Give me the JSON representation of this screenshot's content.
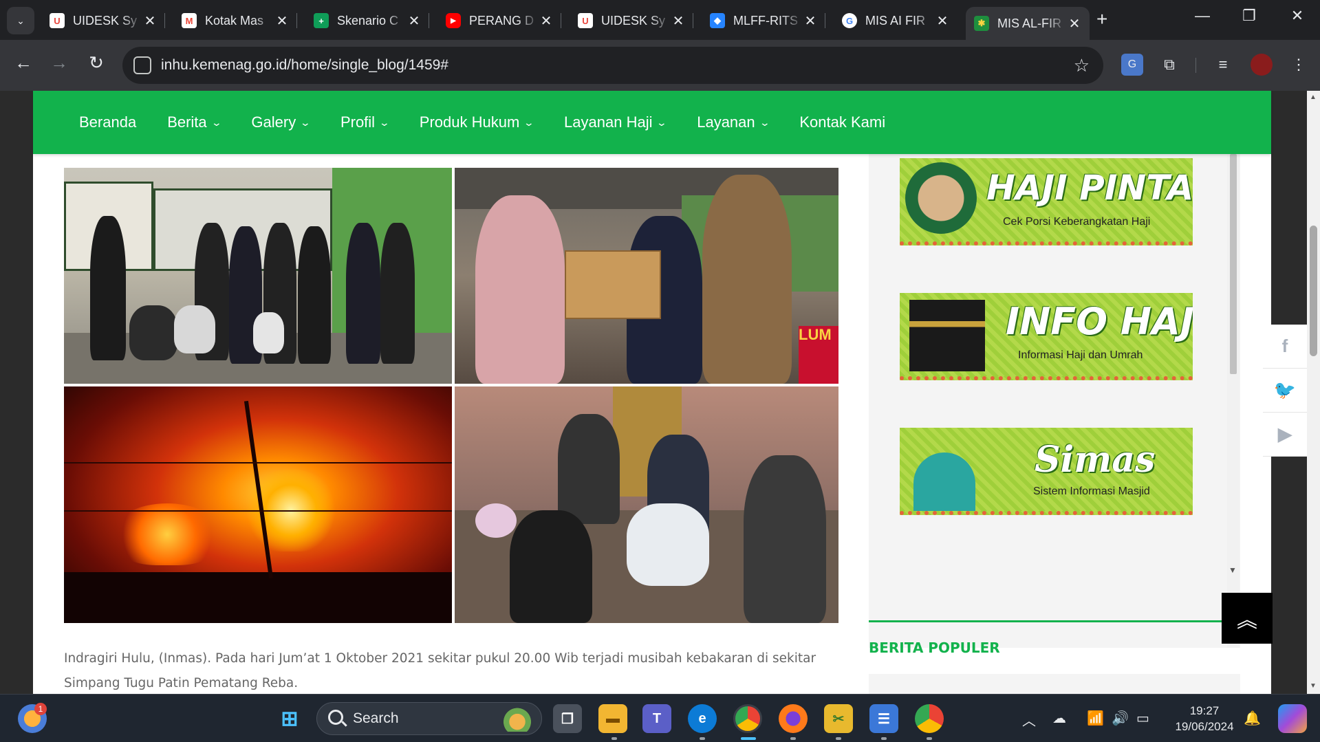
{
  "browser": {
    "tabs": [
      {
        "title": "UIDESK Sy",
        "favicon": "uidesk-icon",
        "color": "#e8453c"
      },
      {
        "title": "Kotak Mas",
        "favicon": "gmail-icon",
        "color": "#ea4335"
      },
      {
        "title": "Skenario C",
        "favicon": "sheets-icon",
        "color": "#0f9d58"
      },
      {
        "title": "PERANG D",
        "favicon": "youtube-icon",
        "color": "#ff0000"
      },
      {
        "title": "UIDESK Sy",
        "favicon": "uidesk-icon",
        "color": "#e8453c"
      },
      {
        "title": "MLFF-RITS",
        "favicon": "jira-icon",
        "color": "#2684ff"
      },
      {
        "title": "MIS AI FIR",
        "favicon": "google-icon",
        "color": "#4285f4"
      },
      {
        "title": "MIS AL-FIR",
        "favicon": "kemenag-icon",
        "color": "#1e8e3e",
        "active": true
      }
    ],
    "url": "inhu.kemenag.go.id/home/single_blog/1459#"
  },
  "nav": {
    "items": [
      {
        "label": "Beranda",
        "dropdown": false
      },
      {
        "label": "Berita",
        "dropdown": true
      },
      {
        "label": "Galery",
        "dropdown": true
      },
      {
        "label": "Profil",
        "dropdown": true
      },
      {
        "label": "Produk Hukum",
        "dropdown": true
      },
      {
        "label": "Layanan Haji",
        "dropdown": true
      },
      {
        "label": "Layanan",
        "dropdown": true
      },
      {
        "label": "Kontak Kami",
        "dropdown": false
      }
    ]
  },
  "article": {
    "text": "Indragiri Hulu, (Inmas). Pada hari Jum’at 1 Oktober 2021 sekitar pukul 20.00 Wib terjadi musibah kebakaran di sekitar Simpang Tugu Patin Pematang Reba."
  },
  "sidebar": {
    "banners": [
      {
        "title": "HAJI PINTAR",
        "subtitle": "Cek Porsi Keberangkatan Haji"
      },
      {
        "title": "INFO HAJI",
        "subtitle": "Informasi Haji dan Umrah"
      },
      {
        "title": "Simas",
        "subtitle": "Sistem Informasi Masjid"
      }
    ],
    "popular_title": "BERITA POPULER"
  },
  "social": [
    "facebook-icon",
    "twitter-icon",
    "youtube-icon"
  ],
  "taskbar": {
    "search_placeholder": "Search",
    "time": "19:27",
    "date": "19/06/2024",
    "notification_count": "1"
  },
  "colors": {
    "accent_green": "#12b24c",
    "tab_bg": "#202124",
    "toolbar_bg": "#35363a"
  }
}
